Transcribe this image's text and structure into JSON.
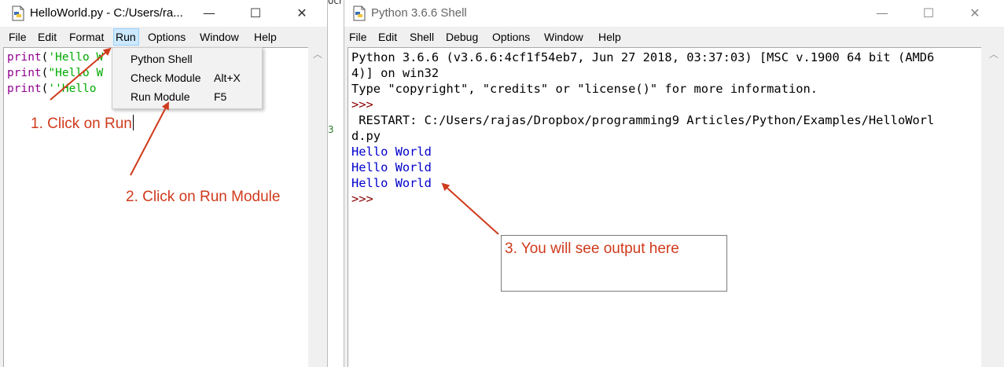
{
  "editor": {
    "title": "HelloWorld.py - C:/Users/ra...",
    "controls": {
      "minimize": "—",
      "maximize": "☐",
      "close": "✕"
    },
    "menu": [
      "File",
      "Edit",
      "Format",
      "Run",
      "Options",
      "Window",
      "Help"
    ],
    "active_menu": "Run",
    "code_lines": [
      {
        "fn": "print",
        "open": "(",
        "str": "'Hello W"
      },
      {
        "fn": "print",
        "open": "(",
        "str": "\"Hello W"
      },
      {
        "fn": "print",
        "open": "(",
        "str": "''Hello"
      }
    ],
    "run_menu": [
      {
        "label": "Python Shell",
        "accel": ""
      },
      {
        "label": "Check Module",
        "accel": "Alt+X"
      },
      {
        "label": "Run Module",
        "accel": "F5"
      }
    ]
  },
  "shell": {
    "title": "Python 3.6.6 Shell",
    "controls": {
      "minimize": "—",
      "maximize": "☐",
      "close": "✕"
    },
    "menu": [
      "File",
      "Edit",
      "Shell",
      "Debug",
      "Options",
      "Window",
      "Help"
    ],
    "lines": {
      "banner1": "Python 3.6.6 (v3.6.6:4cf1f54eb7, Jun 27 2018, 03:37:03) [MSC v.1900 64 bit (AMD6",
      "banner2": "4)] on win32",
      "banner3": "Type \"copyright\", \"credits\" or \"license()\" for more information.",
      "prompt1": ">>>",
      "restart1": " RESTART: C:/Users/rajas/Dropbox/programming9 Articles/Python/Examples/HelloWorl",
      "restart2": "d.py",
      "output": [
        "Hello World",
        "Hello World",
        "Hello World"
      ],
      "prompt2": ">>>"
    }
  },
  "annotations": {
    "step1": "1. Click on Run",
    "step2": "2. Click on Run Module",
    "step3": "3. You will see output here",
    "color": "#d03a1c"
  },
  "background_fragment": "ocr"
}
